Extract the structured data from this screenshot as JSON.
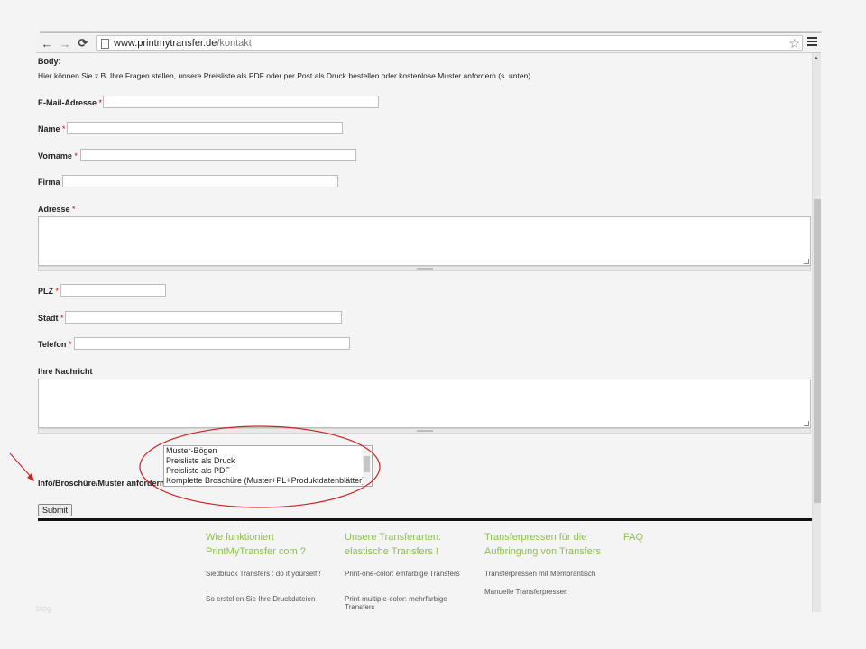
{
  "browser": {
    "url_host": "www.printmytransfer.de",
    "url_path": "/kontakt",
    "back_icon": "←",
    "forward_icon": "→",
    "reload_icon": "⟳",
    "star_icon": "☆"
  },
  "form": {
    "body_label": "Body:",
    "intro": "Hier können Sie z.B. Ihre Fragen stellen, unsere Preisliste als PDF oder per Post als Druck bestellen oder kostenlose Muster anfordern (s. unten)",
    "required_mark": "*",
    "email_label": "E-Mail-Adresse",
    "name_label": "Name",
    "vorname_label": "Vorname",
    "firma_label": "Firma",
    "adresse_label": "Adresse",
    "plz_label": "PLZ",
    "stadt_label": "Stadt",
    "telefon_label": "Telefon",
    "nachricht_label": "Ihre Nachricht",
    "info_label": "Info/Broschüre/Muster anfordern",
    "info_options": [
      "Muster-Bögen",
      "Preisliste als Druck",
      "Preisliste als PDF",
      "Komplette Broschüre (Muster+PL+Produktdatenblätter)"
    ],
    "submit_label": "Submit"
  },
  "footer": {
    "col1_heading": [
      "Wie funktioniert",
      "PrintMyTransfer com ?"
    ],
    "col1_links": [
      "Siedbruck Transfers : do it yourself !",
      "So erstellen Sie Ihre Druckdateien"
    ],
    "col2_heading": [
      "Unsere Transferarten:",
      "elastische Transfers !"
    ],
    "col2_links": [
      "Print-one-color: einfarbige Transfers",
      "Print-multiple-color: mehrfarbige Transfers"
    ],
    "col3_heading": [
      "Transferpressen für die",
      "Aufbringung von Transfers"
    ],
    "col3_links": [
      "Transferpressen mit Membrantisch",
      "Manuelle Transferpressen"
    ],
    "col4_heading": "FAQ"
  },
  "watermark": "blog",
  "colors": {
    "accent_green": "#8cc04b",
    "annotation_red": "#cc2222",
    "required_red": "#cc0000"
  }
}
